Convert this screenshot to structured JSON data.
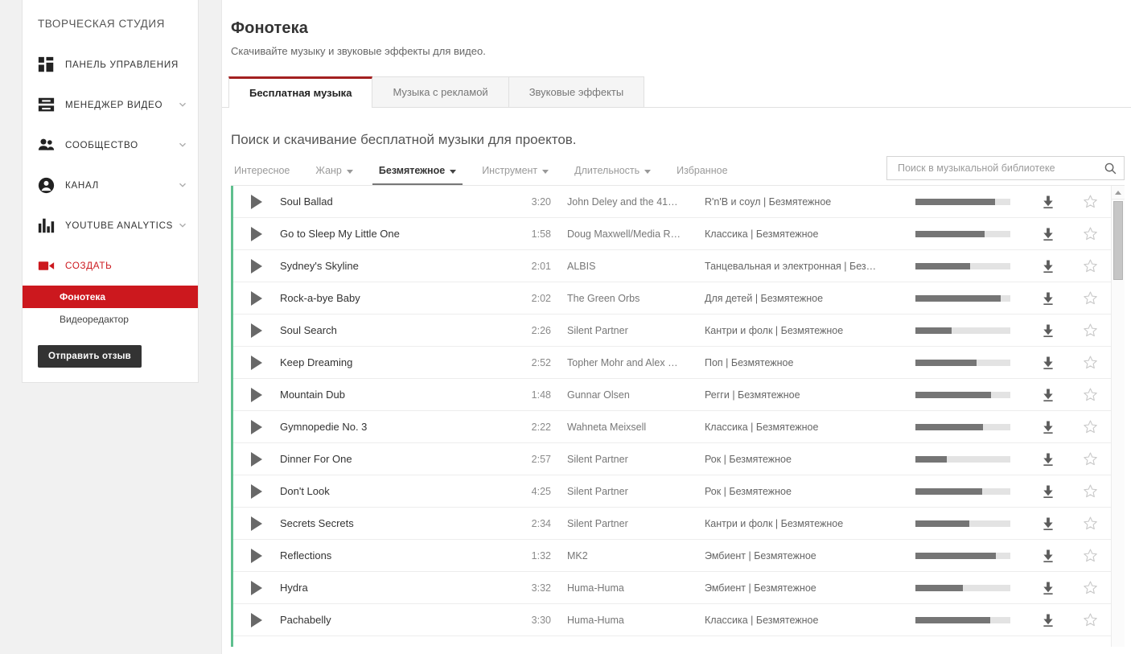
{
  "sidebar": {
    "studio_title": "ТВОРЧЕСКАЯ СТУДИЯ",
    "items": [
      {
        "label": "ПАНЕЛЬ УПРАВЛЕНИЯ",
        "icon": "dashboard-icon",
        "expandable": false
      },
      {
        "label": "МЕНЕДЖЕР ВИДЕО",
        "icon": "video-manager-icon",
        "expandable": true
      },
      {
        "label": "СООБЩЕСТВО",
        "icon": "community-icon",
        "expandable": true
      },
      {
        "label": "КАНАЛ",
        "icon": "channel-icon",
        "expandable": true
      },
      {
        "label": "YOUTUBE ANALYTICS",
        "icon": "analytics-icon",
        "expandable": true
      },
      {
        "label": "СОЗДАТЬ",
        "icon": "create-video-icon",
        "expandable": false
      }
    ],
    "sub_items": [
      {
        "label": "Фонотека",
        "active": true
      },
      {
        "label": "Видеоредактор",
        "active": false
      }
    ],
    "feedback_button": "Отправить отзыв"
  },
  "header": {
    "title": "Фонотека",
    "subtitle": "Скачивайте музыку и звуковые эффекты для видео."
  },
  "tabs": [
    {
      "label": "Бесплатная музыка",
      "active": true
    },
    {
      "label": "Музыка с рекламой",
      "active": false
    },
    {
      "label": "Звуковые эффекты",
      "active": false
    }
  ],
  "section_title": "Поиск и скачивание бесплатной музыки для проектов.",
  "filters": [
    {
      "label": "Интересное",
      "dropdown": false,
      "active": false
    },
    {
      "label": "Жанр",
      "dropdown": true,
      "active": false
    },
    {
      "label": "Безмятежное",
      "dropdown": true,
      "active": true
    },
    {
      "label": "Инструмент",
      "dropdown": true,
      "active": false
    },
    {
      "label": "Длительность",
      "dropdown": true,
      "active": false
    },
    {
      "label": "Избранное",
      "dropdown": false,
      "active": false
    }
  ],
  "search": {
    "placeholder": "Поиск в музыкальной библиотеке",
    "value": "",
    "icon": "search-icon"
  },
  "track_table": {
    "columns": [
      "play",
      "title",
      "duration",
      "artist",
      "genre_mood",
      "popularity",
      "download",
      "favorite"
    ],
    "rows": [
      {
        "title": "Soul Ballad",
        "duration": "3:20",
        "artist": "John Deley and the 41…",
        "genre": "R'n'B и соул | Безмятежное",
        "popularity": 84
      },
      {
        "title": "Go to Sleep My Little One",
        "duration": "1:58",
        "artist": "Doug Maxwell/Media R…",
        "genre": "Классика | Безмятежное",
        "popularity": 73
      },
      {
        "title": "Sydney's Skyline",
        "duration": "2:01",
        "artist": "ALBIS",
        "genre": "Танцевальная и электронная | Без…",
        "popularity": 58
      },
      {
        "title": "Rock-a-bye Baby",
        "duration": "2:02",
        "artist": "The Green Orbs",
        "genre": "Для детей | Безмятежное",
        "popularity": 90
      },
      {
        "title": "Soul Search",
        "duration": "2:26",
        "artist": "Silent Partner",
        "genre": "Кантри и фолк | Безмятежное",
        "popularity": 38
      },
      {
        "title": "Keep Dreaming",
        "duration": "2:52",
        "artist": "Topher Mohr and Alex …",
        "genre": "Поп | Безмятежное",
        "popularity": 64
      },
      {
        "title": "Mountain Dub",
        "duration": "1:48",
        "artist": "Gunnar Olsen",
        "genre": "Регги | Безмятежное",
        "popularity": 80
      },
      {
        "title": "Gymnopedie No. 3",
        "duration": "2:22",
        "artist": "Wahneta Meixsell",
        "genre": "Классика | Безмятежное",
        "popularity": 71
      },
      {
        "title": "Dinner For One",
        "duration": "2:57",
        "artist": "Silent Partner",
        "genre": "Рок | Безмятежное",
        "popularity": 33
      },
      {
        "title": "Don't Look",
        "duration": "4:25",
        "artist": "Silent Partner",
        "genre": "Рок | Безмятежное",
        "popularity": 70
      },
      {
        "title": "Secrets Secrets",
        "duration": "2:34",
        "artist": "Silent Partner",
        "genre": "Кантри и фолк | Безмятежное",
        "popularity": 57
      },
      {
        "title": "Reflections",
        "duration": "1:32",
        "artist": "MK2",
        "genre": "Эмбиент | Безмятежное",
        "popularity": 85
      },
      {
        "title": "Hydra",
        "duration": "3:32",
        "artist": "Huma-Huma",
        "genre": "Эмбиент | Безмятежное",
        "popularity": 50
      },
      {
        "title": "Pachabelly",
        "duration": "3:30",
        "artist": "Huma-Huma",
        "genre": "Классика | Безмятежное",
        "popularity": 79
      }
    ]
  },
  "icons": {
    "play": "play-icon",
    "download": "download-icon",
    "favorite": "star-outline-icon",
    "scroll_up": "scroll-up-arrow-icon"
  },
  "colors": {
    "brand_red": "#cc181e",
    "active_tab_border": "#a32020",
    "accent_stripe": "#5fbf8e",
    "popularity_fill": "#757575",
    "popularity_track": "#e3e3e3"
  }
}
